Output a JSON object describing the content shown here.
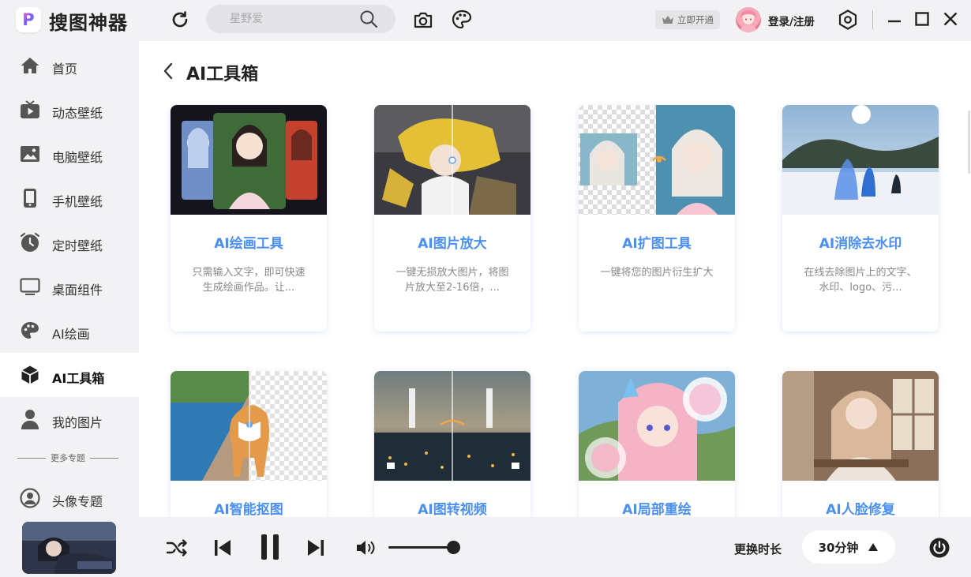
{
  "app": {
    "name": "搜图神器",
    "logo_letter": "P"
  },
  "header": {
    "search_placeholder": "星野爱",
    "vip_label": "立即开通",
    "login_label": "登录/注册"
  },
  "sidebar": {
    "items": [
      {
        "label": "首页",
        "icon": "home-icon"
      },
      {
        "label": "动态壁纸",
        "icon": "tv-play-icon"
      },
      {
        "label": "电脑壁纸",
        "icon": "image-icon"
      },
      {
        "label": "手机壁纸",
        "icon": "phone-icon"
      },
      {
        "label": "定时壁纸",
        "icon": "clock-icon"
      },
      {
        "label": "桌面组件",
        "icon": "monitor-icon"
      },
      {
        "label": "AI绘画",
        "icon": "palette-icon"
      },
      {
        "label": "AI工具箱",
        "icon": "toolbox-icon",
        "active": true
      },
      {
        "label": "我的图片",
        "icon": "user-icon"
      }
    ],
    "more_topics": "更多专题",
    "topic_items": [
      {
        "label": "头像专题",
        "icon": "avatar-icon"
      }
    ]
  },
  "main": {
    "title": "AI工具箱",
    "cards": [
      {
        "title": "AI绘画工具",
        "desc": "只需输入文字，即可快速生成绘画作品。让..."
      },
      {
        "title": "AI图片放大",
        "desc": "一键无损放大图片，将图片放大至2-16倍，..."
      },
      {
        "title": "AI扩图工具",
        "desc": "一键将您的图片衍生扩大"
      },
      {
        "title": "AI消除去水印",
        "desc": "在线去除图片上的文字、水印、logo、污..."
      },
      {
        "title": "AI智能抠图",
        "desc": ""
      },
      {
        "title": "AI图转视频",
        "desc": ""
      },
      {
        "title": "AI局部重绘",
        "desc": ""
      },
      {
        "title": "AI人脸修复",
        "desc": ""
      }
    ]
  },
  "player": {
    "timer_label": "更换时长",
    "timer_value": "30分钟",
    "volume": 0.9
  },
  "colors": {
    "accent": "#4a8ff2",
    "sidebar_bg": "#f2f2f4",
    "text_dark": "#222222"
  }
}
